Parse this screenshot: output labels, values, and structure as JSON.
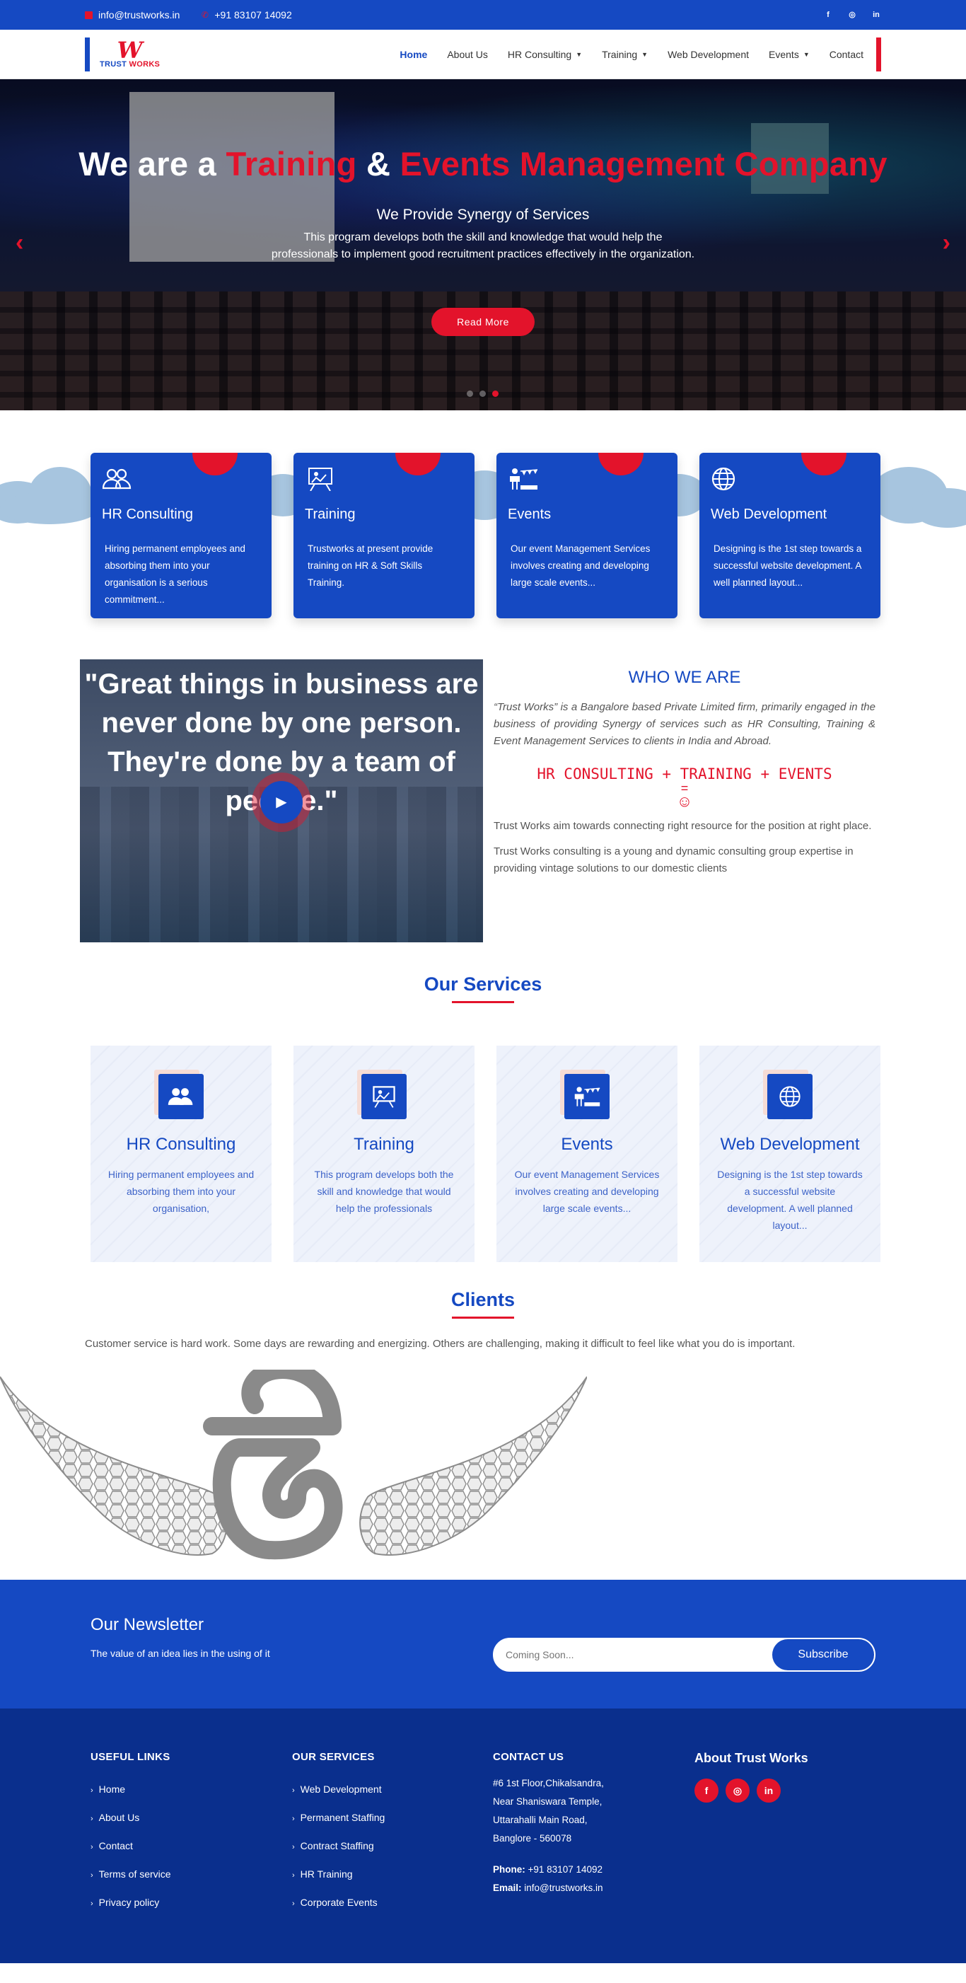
{
  "topbar": {
    "email": "info@trustworks.in",
    "phone": "+91 83107 14092",
    "social": [
      "facebook-icon",
      "whatsapp-icon",
      "linkedin-icon"
    ]
  },
  "header": {
    "logo_mark": "W",
    "logo_text_1": "TRUST",
    "logo_text_2": "WORKS",
    "nav": [
      {
        "label": "Home",
        "active": true
      },
      {
        "label": "About Us"
      },
      {
        "label": "HR Consulting",
        "dropdown": true
      },
      {
        "label": "Training",
        "dropdown": true
      },
      {
        "label": "Web Development"
      },
      {
        "label": "Events",
        "dropdown": true
      },
      {
        "label": "Contact"
      }
    ]
  },
  "hero": {
    "title_1": "We are a ",
    "title_2": "Training",
    "title_3": " & ",
    "title_4": "Events Management Company",
    "subtitle": "We Provide Synergy of Services",
    "description": "This program develops both the skill and knowledge that would help the professionals to implement good recruitment practices effectively in the organization.",
    "button": "Read More",
    "prev": "‹",
    "next": "›",
    "active_slide": 3,
    "slides": 3
  },
  "features": [
    {
      "title": "HR Consulting",
      "text": "Hiring permanent employees and absorbing them into your organisation is a serious commitment...",
      "icon": "users-icon"
    },
    {
      "title": "Training",
      "text": "Trustworks at present provide training on HR & Soft Skills Training.",
      "icon": "presentation-icon"
    },
    {
      "title": "Events",
      "text": "Our event Management Services involves creating and developing large scale events...",
      "icon": "event-icon"
    },
    {
      "title": "Web Development",
      "text": "Designing is the 1st step towards a successful website development. A well planned layout...",
      "icon": "globe-icon"
    }
  ],
  "who": {
    "quote": "\"Great things in business are never done by one person. They're done by a team of people.\"",
    "heading": "WHO WE ARE",
    "intro": "“Trust Works” is a Bangalore based Private Limited firm, primarily engaged in the business of providing Synergy of services such as HR Consulting, Training & Event Management Services to clients in India and Abroad.",
    "tagline": "HR CONSULTING + TRAINING + EVENTS",
    "equals": "=",
    "smiley": "☺",
    "p1": "Trust Works aim towards connecting right resource for the position at right place.",
    "p2": "Trust Works consulting is a young and dynamic consulting group expertise in providing vintage solutions to our domestic clients"
  },
  "services": {
    "title": "Our Services",
    "items": [
      {
        "title": "HR Consulting",
        "text": "Hiring permanent employees and absorbing them into your organisation,",
        "icon": "users-icon"
      },
      {
        "title": "Training",
        "text": "This program develops both the skill and knowledge that would help the professionals",
        "icon": "presentation-icon"
      },
      {
        "title": "Events",
        "text": "Our event Management Services involves creating and developing large scale events...",
        "icon": "event-icon"
      },
      {
        "title": "Web Development",
        "text": "Designing is the 1st step towards a successful website development. A well planned layout...",
        "icon": "globe-icon"
      }
    ]
  },
  "clients": {
    "title": "Clients",
    "text": "Customer service is hard work. Some days are rewarding and energizing. Others are challenging, making it difficult to feel like what you do is important."
  },
  "newsletter": {
    "title": "Our Newsletter",
    "text": "The value of an idea lies in the using of it",
    "placeholder": "Coming Soon...",
    "button": "Subscribe"
  },
  "footer": {
    "useful_title": "USEFUL LINKS",
    "useful": [
      "Home",
      "About Us",
      "Contact",
      "Terms of service",
      "Privacy policy"
    ],
    "services_title": "OUR SERVICES",
    "services": [
      "Web Development",
      "Permanent Staffing",
      "Contract Staffing",
      "HR Training",
      "Corporate Events"
    ],
    "contact_title": "CONTACT US",
    "address": [
      "#6 1st Floor,Chikalsandra,",
      "Near Shaniswara Temple,",
      "Uttarahalli Main Road,",
      "Banglore - 560078"
    ],
    "phone_label": "Phone:",
    "phone": "+91 83107 14092",
    "email_label": "Email:",
    "email": "info@trustworks.in",
    "about_title": "About Trust Works",
    "social": [
      "facebook-icon",
      "whatsapp-icon",
      "linkedin-icon"
    ]
  },
  "colors": {
    "brand_blue": "#1549c2",
    "accent_red": "#e3132b",
    "footer_blue": "#0a2f8d"
  }
}
